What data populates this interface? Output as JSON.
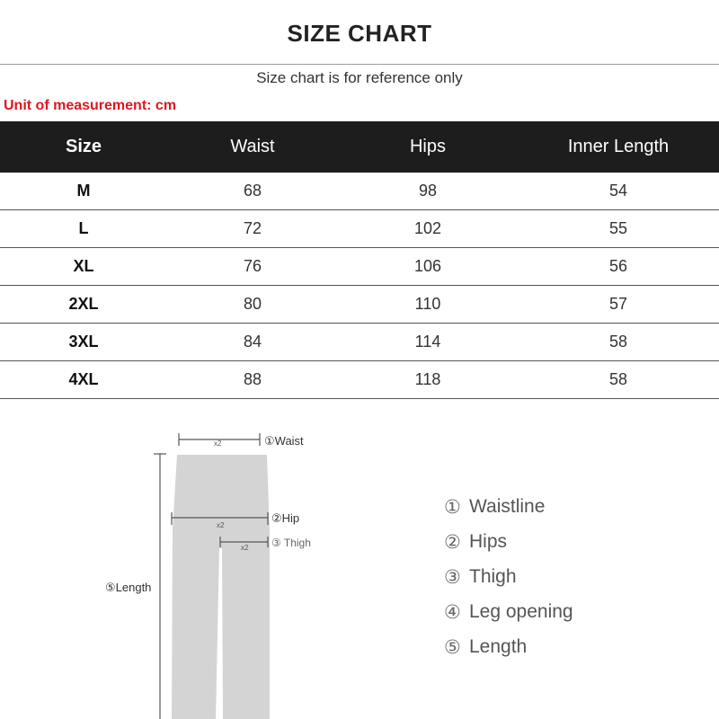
{
  "title": "SIZE CHART",
  "subtitle": "Size chart is for reference only",
  "unit_note": "Unit of measurement: cm",
  "table": {
    "headers": [
      "Size",
      "Waist",
      "Hips",
      "Inner Length"
    ],
    "rows": [
      [
        "M",
        "68",
        "98",
        "54"
      ],
      [
        "L",
        "72",
        "102",
        "55"
      ],
      [
        "XL",
        "76",
        "106",
        "56"
      ],
      [
        "2XL",
        "80",
        "110",
        "57"
      ],
      [
        "3XL",
        "84",
        "114",
        "58"
      ],
      [
        "4XL",
        "88",
        "118",
        "58"
      ]
    ]
  },
  "diagram": {
    "waist_label": "①Waist",
    "hip_label": "②Hip",
    "thigh_label": "③ Thigh",
    "length_label": "⑤Length",
    "x2_marker": "x2"
  },
  "legend": [
    {
      "num": "①",
      "text": "Waistline"
    },
    {
      "num": "②",
      "text": "Hips"
    },
    {
      "num": "③",
      "text": "Thigh"
    },
    {
      "num": "④",
      "text": "Leg opening"
    },
    {
      "num": "⑤",
      "text": "Length"
    }
  ],
  "colors": {
    "header_bg": "#1d1d1d",
    "unit_text": "#e0161f",
    "pants_fill": "#d4d4d4"
  }
}
